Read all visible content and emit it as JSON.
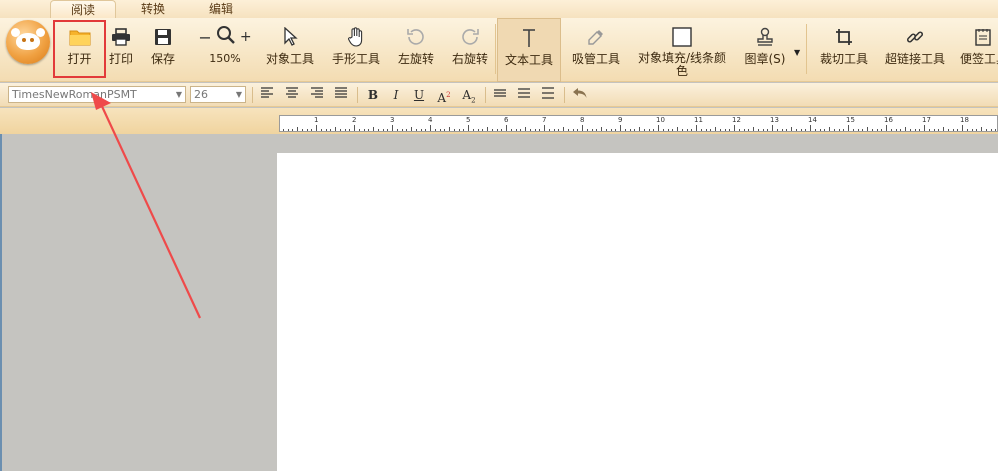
{
  "tabs": {
    "read": "阅读",
    "convert": "转换",
    "edit": "编辑"
  },
  "toolbar": {
    "open": "打开",
    "print": "打印",
    "save": "保存",
    "zoom_level": "150%",
    "object_tool": "对象工具",
    "hand_tool": "手形工具",
    "rotate_left": "左旋转",
    "rotate_right": "右旋转",
    "text_tool": "文本工具",
    "picker_tool": "吸管工具",
    "fill_color": "对象填充/线条颜色",
    "stamp": "图章(S)",
    "crop_tool": "裁切工具",
    "link_tool": "超链接工具",
    "note_tool": "便签工具"
  },
  "format": {
    "font_family": "TimesNewRomanPSMT",
    "font_size": "26"
  },
  "ruler": {
    "labels": [
      "1",
      "2",
      "3",
      "4",
      "5",
      "6",
      "7",
      "8",
      "9",
      "10",
      "11",
      "12",
      "13",
      "14",
      "15",
      "16",
      "17",
      "18"
    ]
  },
  "colors": {
    "highlight": "#e23a3a",
    "accent": "#f0a142"
  }
}
